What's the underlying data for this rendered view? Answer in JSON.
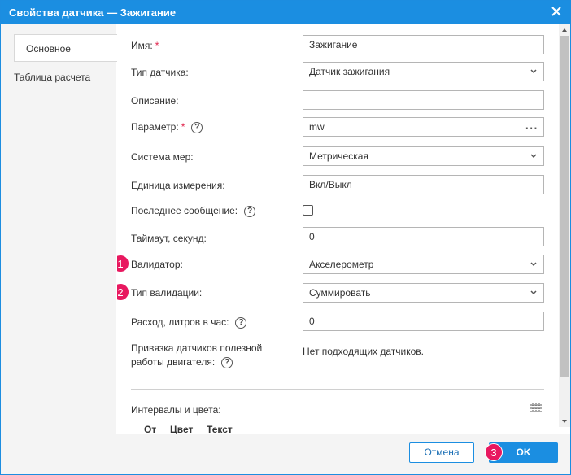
{
  "window": {
    "title": "Свойства датчика — Зажигание"
  },
  "sidebar": {
    "tabs": [
      {
        "label": "Основное"
      },
      {
        "label": "Таблица расчета"
      }
    ]
  },
  "form": {
    "name": {
      "label": "Имя:",
      "required": "*",
      "value": "Зажигание"
    },
    "sensor_type": {
      "label": "Тип датчика:",
      "value": "Датчик зажигания"
    },
    "description": {
      "label": "Описание:",
      "value": ""
    },
    "parameter": {
      "label": "Параметр:",
      "required": "*",
      "help": "?",
      "value": "mw",
      "more": "···"
    },
    "measure_system": {
      "label": "Система мер:",
      "value": "Метрическая"
    },
    "unit": {
      "label": "Единица измерения:",
      "value": "Вкл/Выкл"
    },
    "last_message": {
      "label": "Последнее сообщение:",
      "help": "?",
      "checked": false
    },
    "timeout": {
      "label": "Таймаут, секунд:",
      "value": "0"
    },
    "validator": {
      "label": "Валидатор:",
      "value": "Акселерометр"
    },
    "validation_type": {
      "label": "Тип валидации:",
      "value": "Суммировать"
    },
    "consumption": {
      "label": "Расход, литров в час:",
      "help": "?",
      "value": "0"
    },
    "engine_binding": {
      "label_line1": "Привязка датчиков полезной",
      "label_line2": "работы двигателя:",
      "help": "?",
      "value": "Нет подходящих датчиков."
    },
    "intervals": {
      "label": "Интервалы и цвета:",
      "columns": [
        "От",
        "Цвет",
        "Текст"
      ]
    }
  },
  "footer": {
    "cancel_label": "Отмена",
    "ok_label": "OK"
  },
  "markers": [
    "1",
    "2",
    "3"
  ],
  "colors": {
    "accent": "#1b8ee1",
    "marker": "#e8185f",
    "required": "#e0224a"
  }
}
